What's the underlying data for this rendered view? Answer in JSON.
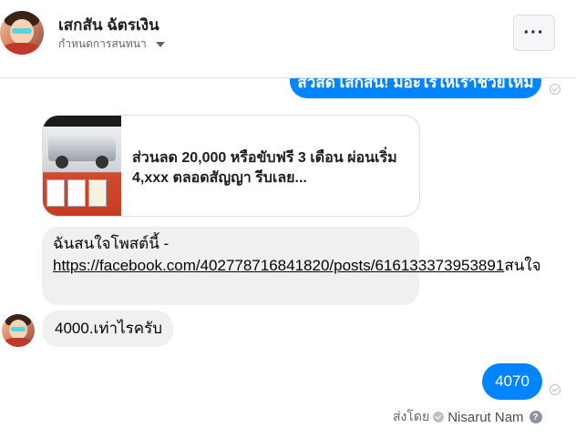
{
  "header": {
    "contact_name": "เสกสัน ฉัตรเงิน",
    "conversation_settings": "กำหนดการสนทนา",
    "more_label": "···"
  },
  "messages": {
    "greeting": "สวัสดี เสกสัน! มีอะไรให้เราช่วยไหม",
    "card_text": "ส่วนลด 20,000 หรือขับฟรี 3 เดือน ผ่อนเริ่ม 4,xxx ตลอดสัญญา รีบเลย...",
    "interest_prefix": "ฉันสนใจโพสต์นี้ -",
    "interest_link": "https://facebook.com/402778716841820/posts/616133373953891",
    "interest_suffix": "สนใจ",
    "price_question": "4000.เท่าไรครับ",
    "reply": "4070"
  },
  "footer": {
    "sent_by_label": "ส่งโดย",
    "sender_name": "Nisarut Nam",
    "help_glyph": "?"
  },
  "colors": {
    "accent": "#0084ff",
    "incoming_bubble": "#f1f0f0"
  }
}
